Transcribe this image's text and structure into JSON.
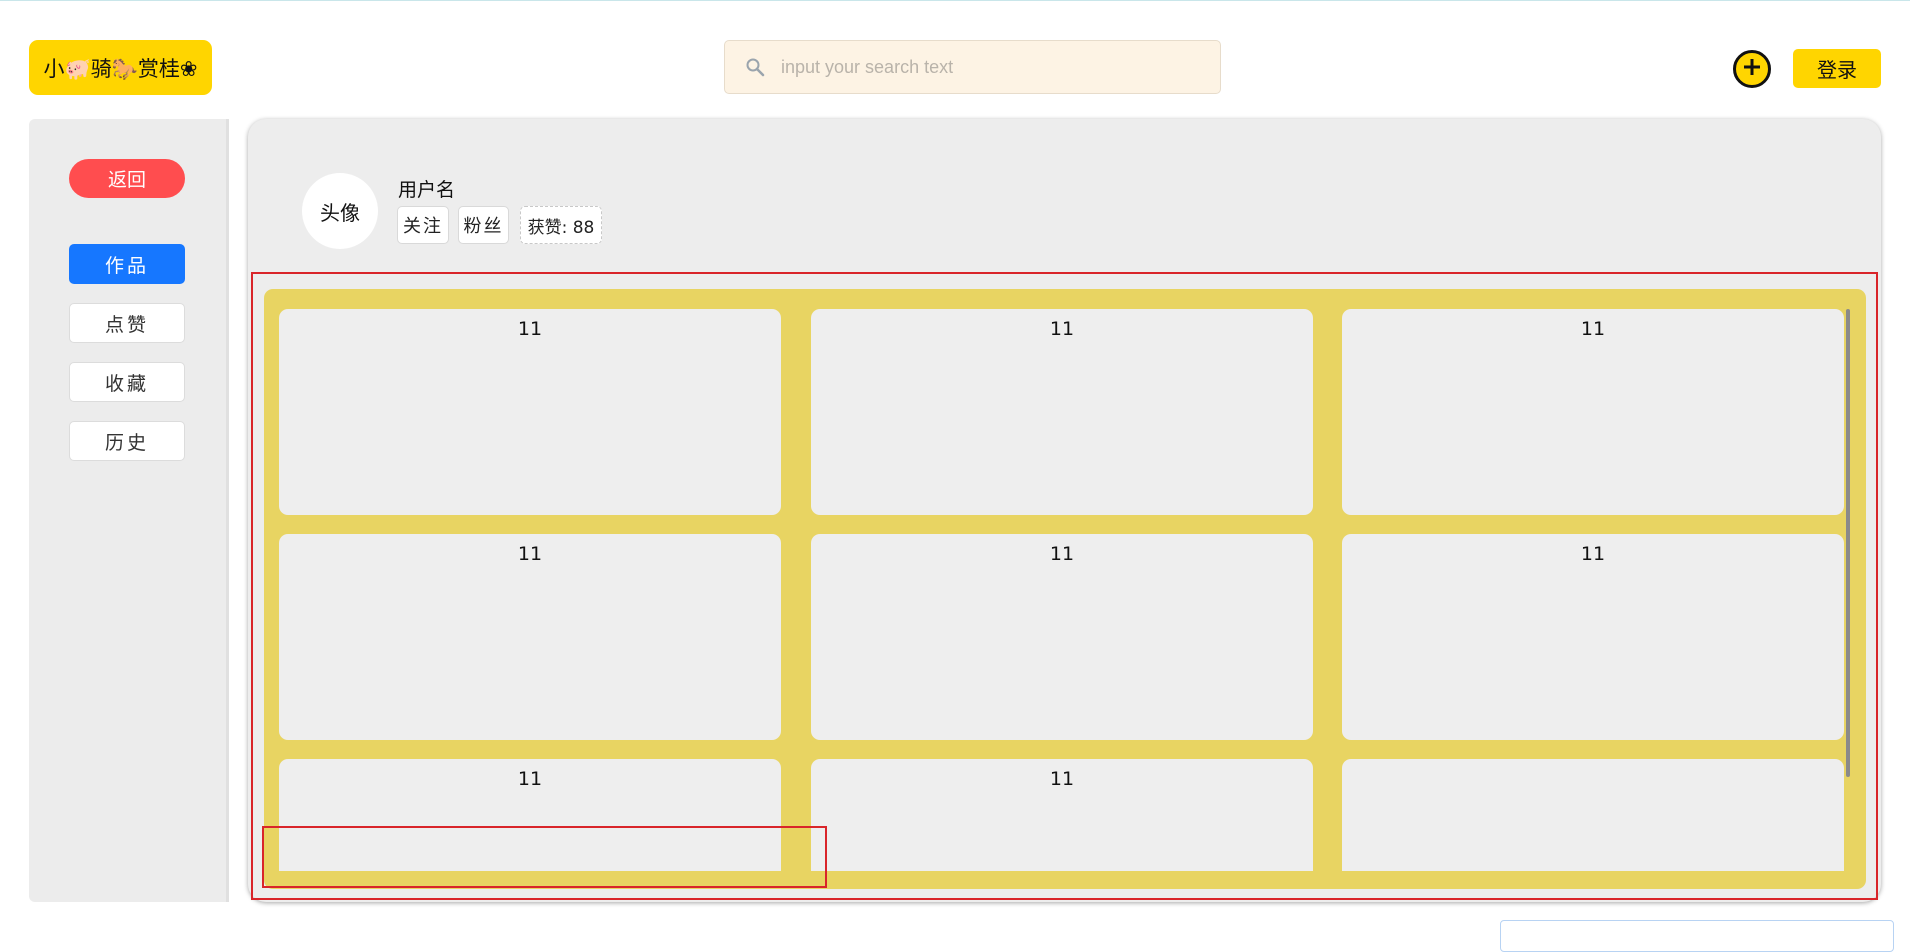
{
  "header": {
    "logo_text": "小🐖骑🐎赏桂❀",
    "search_placeholder": "input your search text",
    "login_label": "登录"
  },
  "sidebar": {
    "back_label": "返回",
    "items": [
      {
        "label": "作品",
        "active": true
      },
      {
        "label": "点赞",
        "active": false
      },
      {
        "label": "收藏",
        "active": false
      },
      {
        "label": "历史",
        "active": false
      }
    ]
  },
  "profile": {
    "avatar_label": "头像",
    "username": "用户名",
    "follow_label": "关注",
    "fans_label": "粉丝",
    "likes_label": "获赞: 88"
  },
  "works": {
    "cards": [
      {
        "title": "11"
      },
      {
        "title": "11"
      },
      {
        "title": "11"
      },
      {
        "title": "11"
      },
      {
        "title": "11"
      },
      {
        "title": "11"
      },
      {
        "title": "11"
      },
      {
        "title": "11"
      },
      {
        "title": ""
      }
    ]
  },
  "colors": {
    "brand_yellow": "#ffd500",
    "back_red": "#ff4d4f",
    "active_blue": "#1677ff",
    "grid_bg": "#e8d462",
    "outline_red": "#d9252a"
  },
  "icons": {
    "search": "magnifier-icon",
    "add": "plus-circle-icon"
  }
}
